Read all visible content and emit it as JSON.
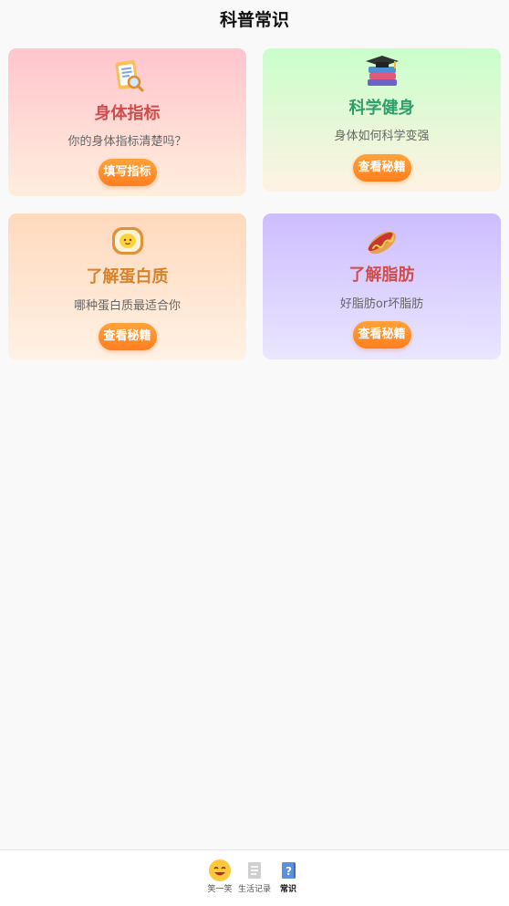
{
  "header": {
    "title": "科普常识"
  },
  "cards": [
    {
      "title": "身体指标",
      "subtitle": "你的身体指标清楚吗？",
      "button": "填写指标",
      "title_color": "#d14d4d",
      "icon": "clipboard-search-icon"
    },
    {
      "title": "科学健身",
      "subtitle": "身体如何科学变强",
      "button": "查看秘籍",
      "title_color": "#2e9f6b",
      "icon": "books-graduation-cap-icon"
    },
    {
      "title": "了解蛋白质",
      "subtitle": "哪种蛋白质最适合你",
      "button": "查看秘籍",
      "title_color": "#d9822b",
      "icon": "egg-toast-icon"
    },
    {
      "title": "了解脂肪",
      "subtitle": "好脂肪or坏脂肪",
      "button": "查看秘籍",
      "title_color": "#d14d4d",
      "icon": "hotdog-icon"
    }
  ],
  "tabbar": {
    "items": [
      {
        "label": "笑一笑",
        "icon": "smile-face-icon",
        "active": false
      },
      {
        "label": "生活记录",
        "icon": "document-icon",
        "active": false
      },
      {
        "label": "常识",
        "icon": "question-book-icon",
        "active": true
      }
    ]
  },
  "colors": {
    "accent_button": "#ff8a25",
    "background": "#f9f9f9"
  }
}
